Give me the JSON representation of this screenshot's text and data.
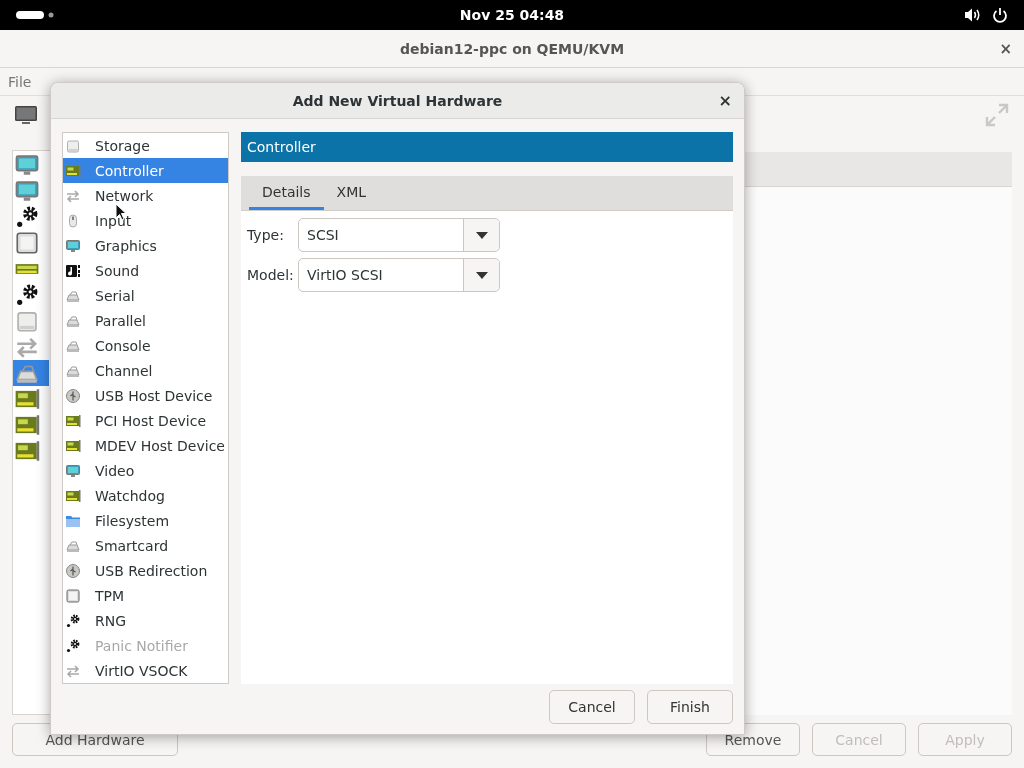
{
  "top_bar": {
    "clock": "Nov 25  04:48"
  },
  "window": {
    "title": "debian12-ppc on QEMU/KVM",
    "close": "×",
    "menu": [
      "File"
    ]
  },
  "sidebar": {
    "items": [
      {
        "kind": "monitor",
        "selected": false
      },
      {
        "kind": "monitor",
        "selected": false
      },
      {
        "kind": "gears",
        "selected": false
      },
      {
        "kind": "chip",
        "selected": false
      },
      {
        "kind": "ram",
        "selected": false
      },
      {
        "kind": "gears",
        "selected": false
      },
      {
        "kind": "disk",
        "selected": false
      },
      {
        "kind": "arrows",
        "selected": false
      },
      {
        "kind": "serial",
        "selected": true
      },
      {
        "kind": "card",
        "selected": false
      },
      {
        "kind": "card",
        "selected": false
      },
      {
        "kind": "card",
        "selected": false
      }
    ]
  },
  "buttons": [
    {
      "label": "Add Hardware",
      "disabled": false
    },
    {
      "label": "Remove",
      "disabled": false
    },
    {
      "label": "Cancel",
      "disabled": true
    },
    {
      "label": "Apply",
      "disabled": true
    }
  ],
  "dialog": {
    "title": "Add New Virtual Hardware",
    "close": "×",
    "items": [
      {
        "label": "Storage",
        "kind": "disk",
        "selected": false,
        "disabled": false
      },
      {
        "label": "Controller",
        "kind": "card",
        "selected": true,
        "disabled": false
      },
      {
        "label": "Network",
        "kind": "arrows",
        "selected": false,
        "disabled": false
      },
      {
        "label": "Input",
        "kind": "mouse",
        "selected": false,
        "disabled": false
      },
      {
        "label": "Graphics",
        "kind": "monitor",
        "selected": false,
        "disabled": false
      },
      {
        "label": "Sound",
        "kind": "sound",
        "selected": false,
        "disabled": false
      },
      {
        "label": "Serial",
        "kind": "serial",
        "selected": false,
        "disabled": false
      },
      {
        "label": "Parallel",
        "kind": "serial",
        "selected": false,
        "disabled": false
      },
      {
        "label": "Console",
        "kind": "serial",
        "selected": false,
        "disabled": false
      },
      {
        "label": "Channel",
        "kind": "serial",
        "selected": false,
        "disabled": false
      },
      {
        "label": "USB Host Device",
        "kind": "usb",
        "selected": false,
        "disabled": false
      },
      {
        "label": "PCI Host Device",
        "kind": "card",
        "selected": false,
        "disabled": false
      },
      {
        "label": "MDEV Host Device",
        "kind": "card",
        "selected": false,
        "disabled": false
      },
      {
        "label": "Video",
        "kind": "monitor",
        "selected": false,
        "disabled": false
      },
      {
        "label": "Watchdog",
        "kind": "card",
        "selected": false,
        "disabled": false
      },
      {
        "label": "Filesystem",
        "kind": "folder",
        "selected": false,
        "disabled": false
      },
      {
        "label": "Smartcard",
        "kind": "serial",
        "selected": false,
        "disabled": false
      },
      {
        "label": "USB Redirection",
        "kind": "usb",
        "selected": false,
        "disabled": false
      },
      {
        "label": "TPM",
        "kind": "chip",
        "selected": false,
        "disabled": false
      },
      {
        "label": "RNG",
        "kind": "gears",
        "selected": false,
        "disabled": false
      },
      {
        "label": "Panic Notifier",
        "kind": "gears",
        "selected": false,
        "disabled": true
      },
      {
        "label": "VirtIO VSOCK",
        "kind": "arrows",
        "selected": false,
        "disabled": false
      }
    ],
    "header": "Controller",
    "tabs": [
      {
        "label": "Details",
        "selected": true
      },
      {
        "label": "XML",
        "selected": false
      }
    ],
    "fields": [
      {
        "label": "Type:",
        "value": "SCSI"
      },
      {
        "label": "Model:",
        "value": "VirtIO SCSI"
      }
    ],
    "buttons": [
      "Cancel",
      "Finish"
    ]
  }
}
